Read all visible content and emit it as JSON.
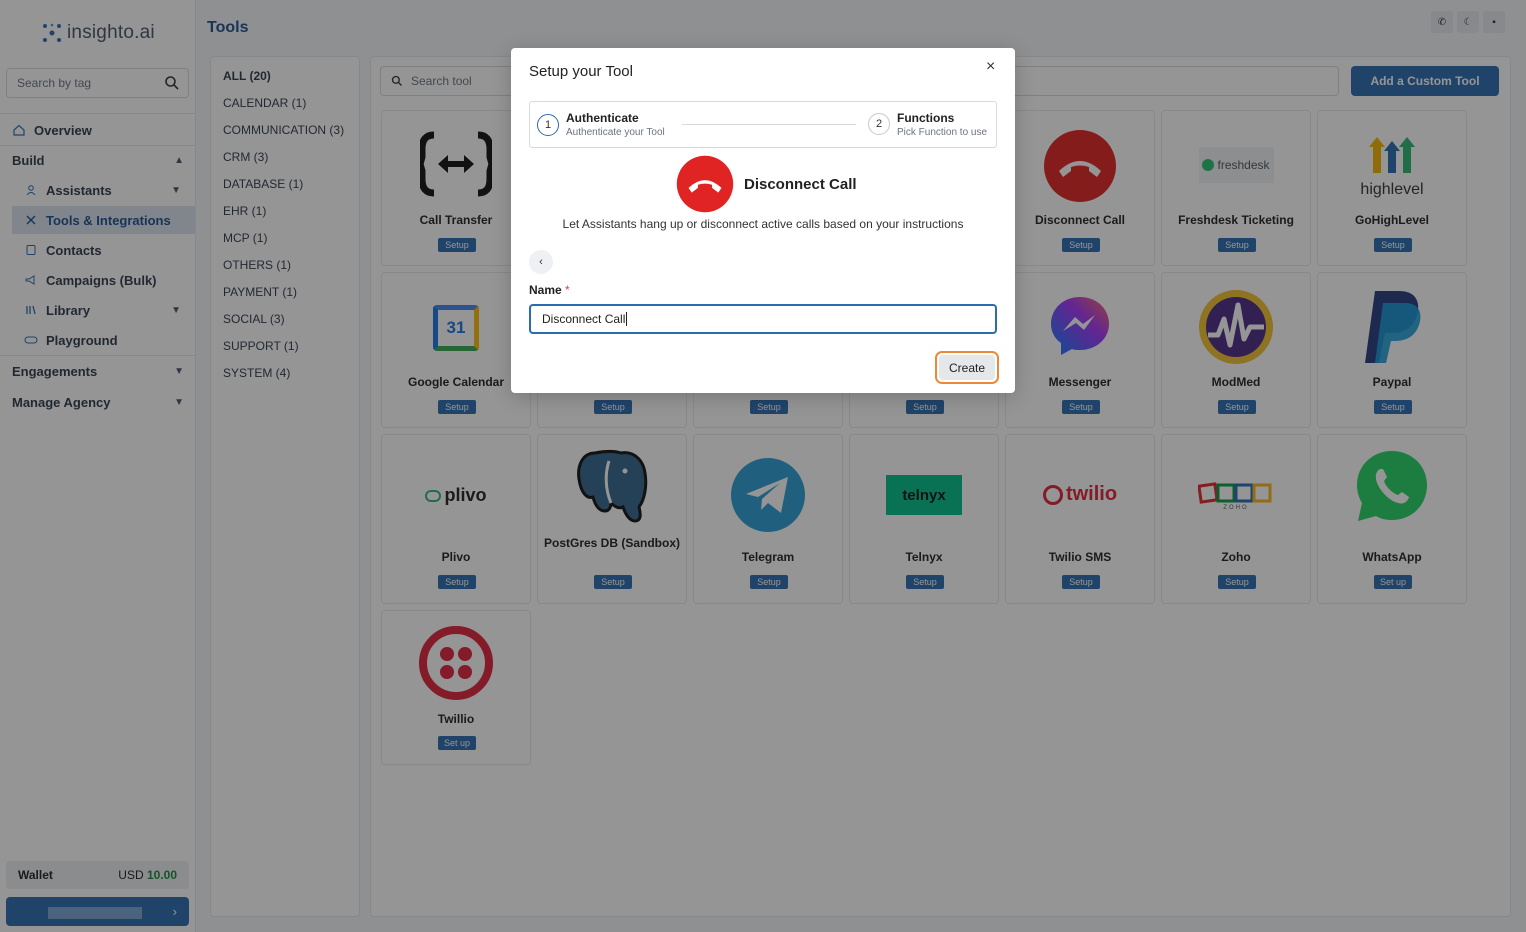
{
  "brand": {
    "name": "insighto.ai"
  },
  "sidebar": {
    "search_placeholder": "Search by tag",
    "overview": "Overview",
    "build": "Build",
    "assistants": "Assistants",
    "tools": "Tools & Integrations",
    "contacts": "Contacts",
    "campaigns": "Campaigns (Bulk)",
    "library": "Library",
    "playground": "Playground",
    "engagements": "Engagements",
    "manage_agency": "Manage Agency",
    "wallet_label": "Wallet",
    "wallet_currency": "USD",
    "wallet_amount": "10.00",
    "user_chevron": "›"
  },
  "page": {
    "title": "Tools"
  },
  "categories": [
    "ALL (20)",
    "CALENDAR (1)",
    "COMMUNICATION (3)",
    "CRM (3)",
    "DATABASE (1)",
    "EHR (1)",
    "MCP (1)",
    "OTHERS (1)",
    "PAYMENT (1)",
    "SOCIAL (3)",
    "SUPPORT (1)",
    "SYSTEM (4)"
  ],
  "toolbar": {
    "search_placeholder": "Search tool",
    "add_button": "Add a Custom Tool"
  },
  "tools": [
    {
      "name": "Call Transfer",
      "setup": "Setup"
    },
    {
      "name": "Disconnect Call",
      "setup": "Setup"
    },
    {
      "name": "Freshdesk Ticketing",
      "setup": "Setup",
      "logo_text": "freshdesk"
    },
    {
      "name": "GoHighLevel",
      "setup": "Setup",
      "logo_text": "highlevel"
    },
    {
      "name": "Google Calendar",
      "setup": "Setup",
      "logo_text": "31"
    },
    {
      "name": "",
      "setup": "Setup"
    },
    {
      "name": "",
      "setup": "Setup"
    },
    {
      "name": "",
      "setup": "Setup"
    },
    {
      "name": "Messenger",
      "setup": "Setup"
    },
    {
      "name": "ModMed",
      "setup": "Setup"
    },
    {
      "name": "Paypal",
      "setup": "Setup"
    },
    {
      "name": "Plivo",
      "setup": "Setup",
      "logo_text": "plivo"
    },
    {
      "name": "PostGres DB (Sandbox)",
      "setup": "Setup"
    },
    {
      "name": "Telegram",
      "setup": "Setup"
    },
    {
      "name": "Telnyx",
      "setup": "Setup",
      "logo_text": "telnyx"
    },
    {
      "name": "Twilio SMS",
      "setup": "Setup",
      "logo_text": "twilio"
    },
    {
      "name": "Zoho",
      "setup": "Setup",
      "logo_text": "ZOHO"
    },
    {
      "name": "WhatsApp",
      "setup": "Set up"
    },
    {
      "name": "Twillio",
      "setup": "Set up"
    }
  ],
  "modal": {
    "title": "Setup your Tool",
    "close": "×",
    "step1": {
      "num": "1",
      "title": "Authenticate",
      "sub": "Authenticate your Tool"
    },
    "step2": {
      "num": "2",
      "title": "Functions",
      "sub": "Pick Function to use"
    },
    "tool_name": "Disconnect Call",
    "description": "Let Assistants hang up or disconnect active calls based on your instructions",
    "back": "‹",
    "name_label": "Name",
    "required_mark": "*",
    "name_value": "Disconnect Call",
    "create_button": "Create"
  },
  "colors": {
    "accent": "#2b6cb0",
    "danger": "#e02424",
    "focus_ring": "#ed8936"
  }
}
